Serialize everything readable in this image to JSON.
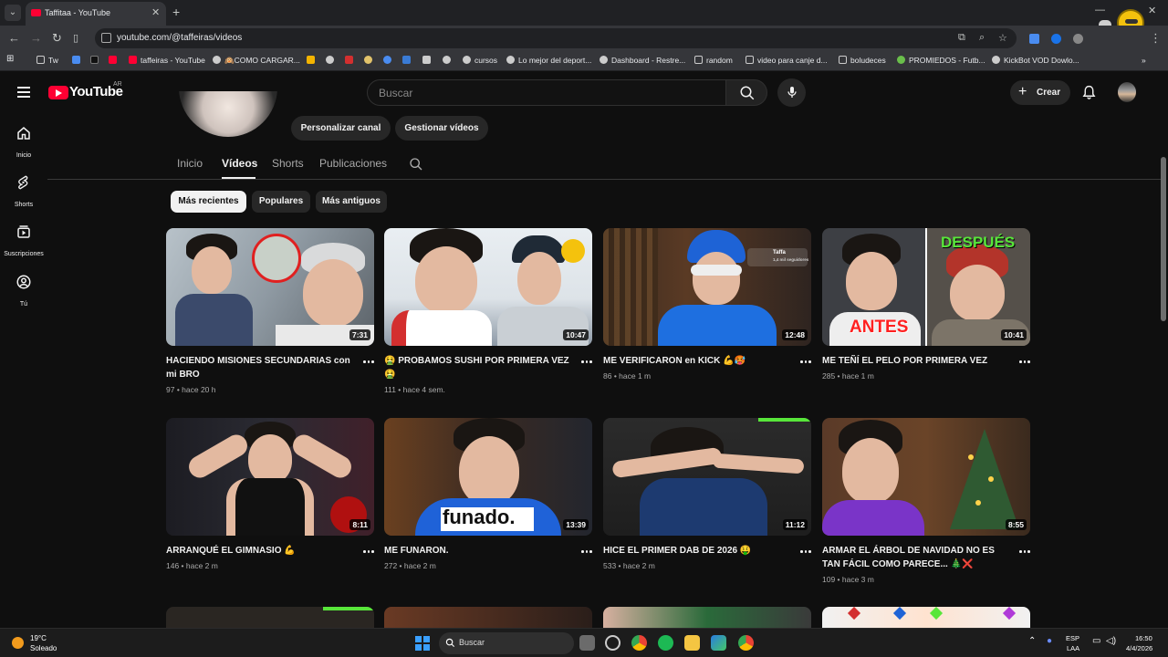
{
  "browser": {
    "tab_title": "Taffitaa - YouTube",
    "url": "youtube.com/@taffeiras/videos",
    "bookmarks": [
      {
        "label": "Tw"
      },
      {
        "label": ""
      },
      {
        "label": ""
      },
      {
        "label": ""
      },
      {
        "label": "taffeiras - YouTube"
      },
      {
        "label": "🙉COMO CARGAR..."
      },
      {
        "label": "cursos"
      },
      {
        "label": "Lo mejor del deport..."
      },
      {
        "label": "Dashboard - Restre..."
      },
      {
        "label": "random"
      },
      {
        "label": "video para canje d..."
      },
      {
        "label": "boludeces"
      },
      {
        "label": "PROMIEDOS - Futb..."
      },
      {
        "label": "KickBot VOD Dowlo..."
      }
    ]
  },
  "masthead": {
    "logo_text": "YouTube",
    "country": "AR",
    "search_placeholder": "Buscar",
    "create_label": "Crear"
  },
  "guide": [
    {
      "label": "Inicio",
      "icon": "home-icon"
    },
    {
      "label": "Shorts",
      "icon": "shorts-icon"
    },
    {
      "label": "Suscripciones",
      "icon": "subscriptions-icon"
    },
    {
      "label": "Tú",
      "icon": "you-icon"
    }
  ],
  "channel": {
    "buttons": [
      "Personalizar canal",
      "Gestionar vídeos"
    ],
    "tabs": [
      "Inicio",
      "Vídeos",
      "Shorts",
      "Publicaciones"
    ],
    "active_tab": "Vídeos",
    "chips": [
      "Más recientes",
      "Populares",
      "Más antiguos"
    ],
    "active_chip": "Más recientes"
  },
  "videos": [
    {
      "title": "HACIENDO MISIONES SECUNDARIAS con mi BRO",
      "meta": "97 • hace 20 h",
      "duration": "7:31"
    },
    {
      "title": "🤮 PROBAMOS SUSHI POR PRIMERA VEZ 🤮",
      "meta": "111 • hace 4 sem.",
      "duration": "10:47"
    },
    {
      "title": "ME VERIFICARON en KICK 💪🥵",
      "meta": "86 • hace 1 m",
      "duration": "12:48"
    },
    {
      "title": "ME TEÑÍ EL PELO POR PRIMERA VEZ",
      "meta": "285 • hace 1 m",
      "duration": "10:41"
    },
    {
      "title": "ARRANQUÉ EL GIMNASIO 💪",
      "meta": "146 • hace 2 m",
      "duration": "8:11"
    },
    {
      "title": "ME FUNARON.",
      "meta": "272 • hace 2 m",
      "duration": "13:39"
    },
    {
      "title": "HICE EL PRIMER DAB DE 2026 🤑",
      "meta": "533 • hace 2 m",
      "duration": "11:12"
    },
    {
      "title": "ARMAR EL ÁRBOL DE NAVIDAD NO ES TAN FÁCIL COMO PARECE... 🎄❌",
      "meta": "109 • hace 3 m",
      "duration": "8:55"
    }
  ],
  "thumb_text": {
    "despues": "DESPUÉS",
    "antes": "ANTES",
    "funado": "funado.",
    "taffa": "Taffa",
    "followers": "1,4 mil seguidores"
  },
  "taskbar": {
    "temp": "19°C",
    "weather": "Soleado",
    "search_label": "Buscar",
    "lang": "ESP",
    "lang_sub": "LAA",
    "time": "16:50",
    "date": "4/4/2026"
  },
  "colors": {
    "youtube_red": "#ff0033",
    "background": "#0f0f0f",
    "chip_bg": "#272727"
  }
}
